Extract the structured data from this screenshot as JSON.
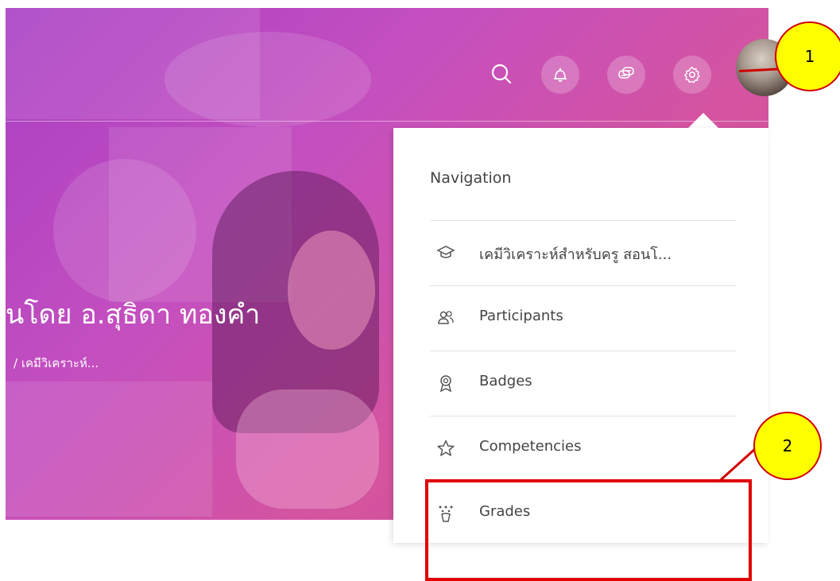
{
  "hero": {
    "course_title": "นโดย อ.สุธิดา ทองคำ",
    "breadcrumb": "/ เคมีวิเคราะห์..."
  },
  "topbar": {
    "icons": [
      "search-icon",
      "bell-icon",
      "chat-icon",
      "gear-icon"
    ]
  },
  "menu": {
    "heading": "Navigation",
    "items": [
      {
        "label": "เคมีวิเคราะห์สำหรับครู สอนโ...",
        "icon": "graduation-cap-icon"
      },
      {
        "label": "Participants",
        "icon": "users-icon"
      },
      {
        "label": "Badges",
        "icon": "badge-icon"
      },
      {
        "label": "Competencies",
        "icon": "star-icon"
      },
      {
        "label": "Grades",
        "icon": "grades-icon"
      }
    ]
  },
  "annotations": {
    "callout_1": "1",
    "callout_2": "2"
  },
  "colors": {
    "hero_start": "#a93fc4",
    "hero_end": "#d5549f",
    "callout_fill": "#ffff00",
    "callout_border": "#d00000"
  }
}
